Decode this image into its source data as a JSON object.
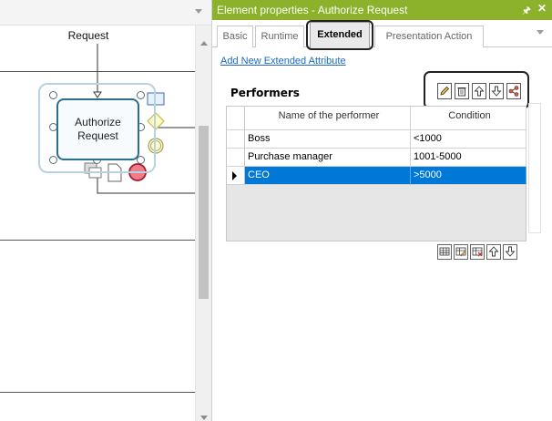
{
  "diagram": {
    "flow_label": "Request",
    "task_label_line1": "Authorize",
    "task_label_line2": "Request"
  },
  "panel": {
    "title": "Element properties - Authorize Request",
    "pin_icon": "pin-icon",
    "close_icon": "close-icon",
    "tabs": [
      {
        "label": "Basic"
      },
      {
        "label": "Runtime"
      },
      {
        "label": "Extended",
        "active": true
      },
      {
        "label": "Presentation Action"
      }
    ],
    "add_link": "Add New Extended Attribute",
    "performers": {
      "title": "Performers",
      "toolbar": [
        "edit-icon",
        "delete-icon",
        "move-up-icon",
        "move-down-icon",
        "share-icon"
      ],
      "columns": [
        "Name of the performer",
        "Condition"
      ],
      "rows": [
        {
          "name": "Boss",
          "condition": "<1000"
        },
        {
          "name": "Purchase manager",
          "condition": "1001-5000"
        },
        {
          "name": "CEO",
          "condition": ">5000",
          "selected": true
        }
      ],
      "bottom_toolbar": [
        "add-row-icon",
        "edit-row-icon",
        "delete-row-icon",
        "move-up-icon",
        "move-down-icon"
      ]
    }
  },
  "colors": {
    "title_bar": "#8cb12a",
    "selection": "#0078d7",
    "link": "#1c69c9"
  }
}
